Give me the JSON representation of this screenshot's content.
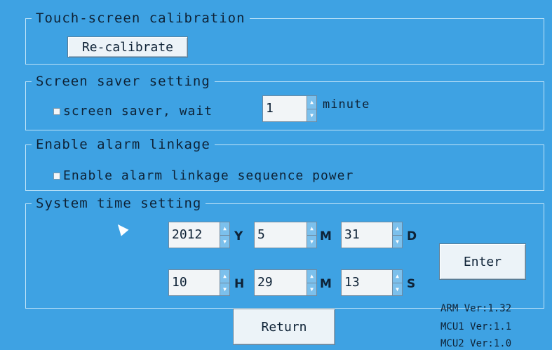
{
  "calibration": {
    "legend": "Touch-screen calibration",
    "button": "Re-calibrate"
  },
  "screensaver": {
    "legend": "Screen saver setting",
    "checkbox_label": "screen saver, wait",
    "wait_value": "1",
    "unit": "minute"
  },
  "alarm": {
    "legend": "Enable alarm linkage",
    "checkbox_label": "Enable alarm linkage sequence power"
  },
  "time": {
    "legend": "System time setting",
    "year": "2012",
    "year_unit": "Y",
    "month": "5",
    "month_unit": "M",
    "day": "31",
    "day_unit": "D",
    "hour": "10",
    "hour_unit": "H",
    "minute": "29",
    "minute_unit": "M",
    "second": "13",
    "second_unit": "S",
    "enter": "Enter"
  },
  "footer": {
    "return": "Return",
    "arm_ver": "ARM Ver:1.32",
    "mcu1_ver": "MCU1 Ver:1.1",
    "mcu2_ver": "MCU2 Ver:1.0"
  }
}
